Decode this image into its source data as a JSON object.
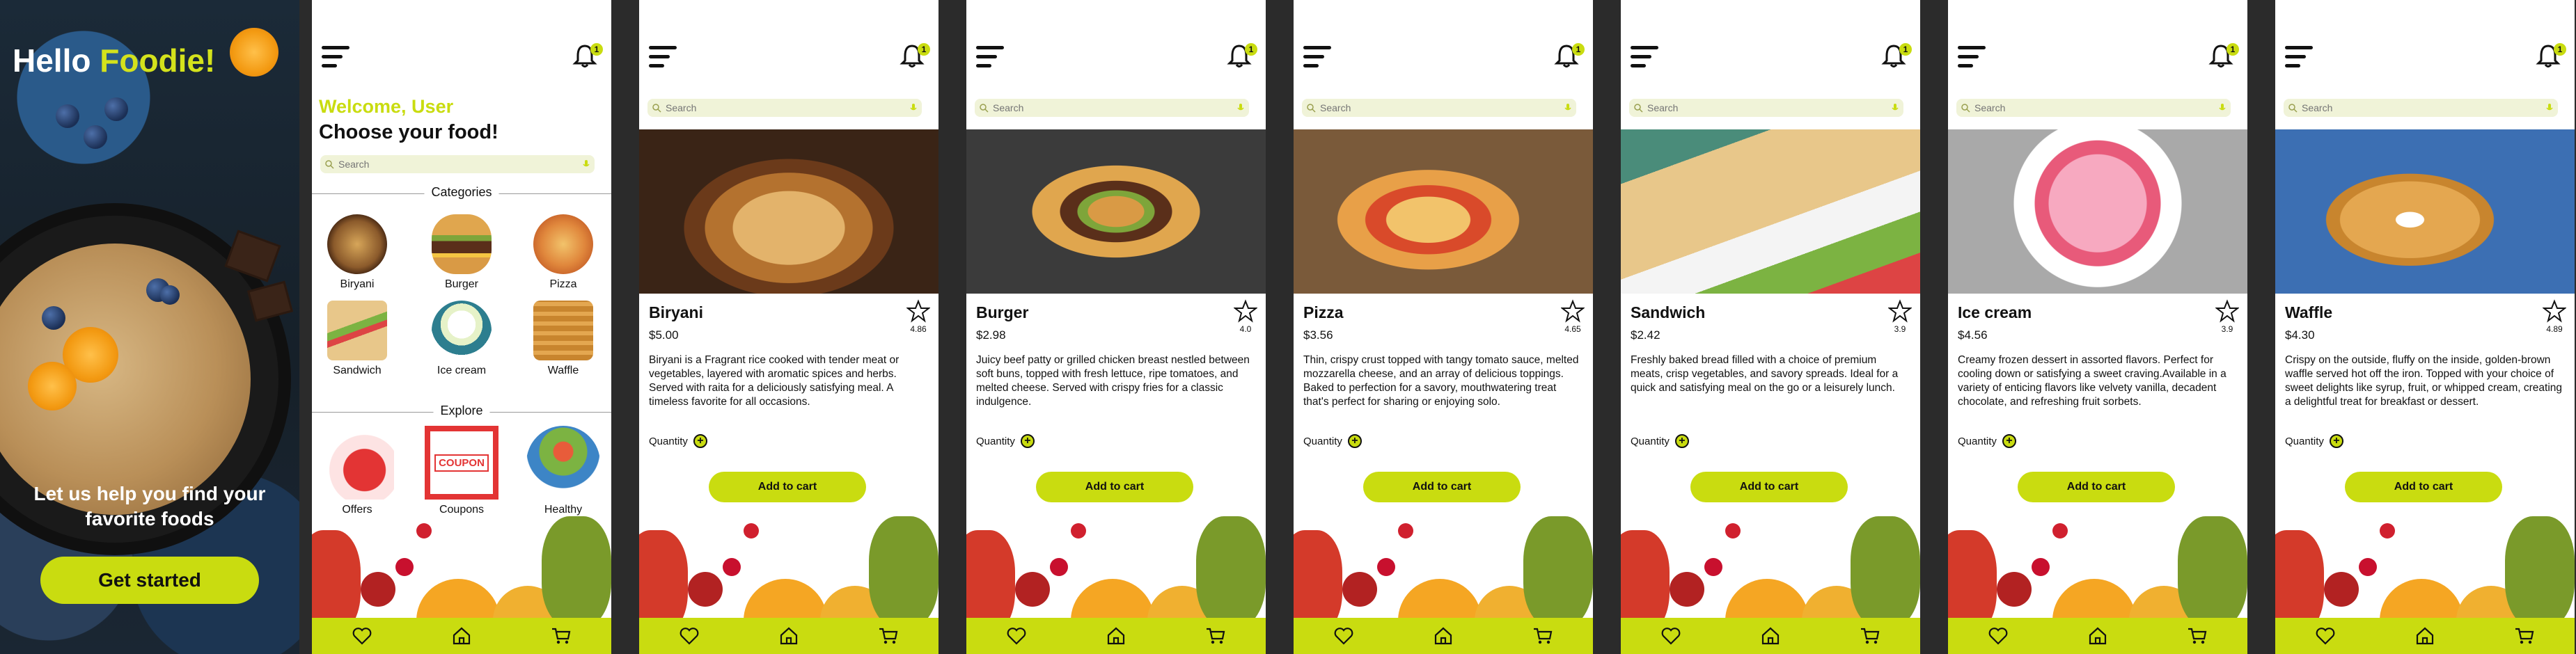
{
  "splash": {
    "title_prefix": "Hello",
    "title_accent": "Foodie!",
    "tagline": "Let us help you find your favorite foods",
    "cta": "Get started"
  },
  "common": {
    "notification_count": "1",
    "search_placeholder": "Search",
    "nav_items": [
      "heart-icon",
      "home-icon",
      "cart-icon"
    ]
  },
  "home": {
    "welcome": "Welcome, User",
    "heading": "Choose your food!",
    "categories_title": "Categories",
    "categories": [
      "Biryani",
      "Burger",
      "Pizza",
      "Sandwich",
      "Ice cream",
      "Waffle"
    ],
    "explore_title": "Explore",
    "explore": [
      "Offers",
      "Coupons",
      "Healthy"
    ],
    "coupon_text": "COUPON"
  },
  "foods": [
    {
      "name": "Biryani",
      "price": "$5.00",
      "rating": "4.86",
      "description": "Biryani is a Fragrant rice cooked with tender meat or vegetables, layered with aromatic spices and herbs. Served with raita for a deliciously satisfying meal. A timeless favorite for all occasions."
    },
    {
      "name": "Burger",
      "price": "$2.98",
      "rating": "4.0",
      "description": "Juicy beef patty or grilled chicken breast nestled between soft buns, topped with fresh lettuce, ripe tomatoes, and melted cheese. Served with crispy fries for a classic indulgence."
    },
    {
      "name": "Pizza",
      "price": "$3.56",
      "rating": "4.65",
      "description": "Thin, crispy crust topped with tangy tomato sauce, melted mozzarella cheese, and an array of delicious toppings. Baked to perfection for a savory, mouthwatering treat that's perfect for sharing or enjoying solo."
    },
    {
      "name": "Sandwich",
      "price": "$2.42",
      "rating": "3.9",
      "description": "Freshly baked bread filled with a choice of premium meats, crisp vegetables, and savory spreads. Ideal for a quick and satisfying meal on the go or a leisurely lunch."
    },
    {
      "name": "Ice cream",
      "price": "$4.56",
      "rating": "3.9",
      "description": "Creamy frozen dessert in assorted flavors. Perfect for cooling down or satisfying a sweet craving.Available in a variety of enticing flavors like velvety vanilla, decadent chocolate, and refreshing fruit sorbets."
    },
    {
      "name": "Waffle",
      "price": "$4.30",
      "rating": "4.89",
      "description": "Crispy on the outside, fluffy on the inside, golden-brown waffle served hot off the iron. Topped with your choice of sweet delights like syrup, fruit, or whipped cream, creating a delightful treat for breakfast or dessert."
    }
  ],
  "detail_labels": {
    "quantity": "Quantity",
    "add_to_cart": "Add to cart"
  },
  "colors": {
    "accent": "#c9dc10",
    "splash_bg": "#18232f",
    "frame_bg": "#2b2b2b"
  }
}
